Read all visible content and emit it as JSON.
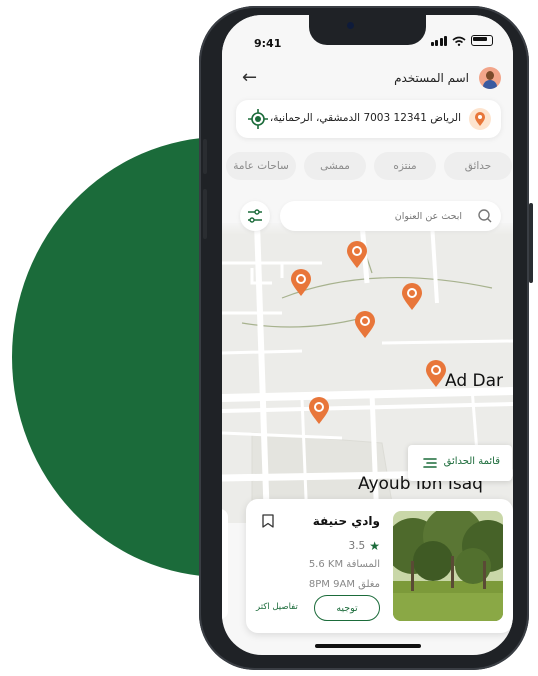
{
  "status_bar": {
    "time": "9:41"
  },
  "header": {
    "user_name": "اسم المستخدم"
  },
  "address": {
    "text": "الرياض 12341 7003 الدمشقي، الرحمانية،"
  },
  "categories": [
    {
      "label": "حدائق"
    },
    {
      "label": "منتزه"
    },
    {
      "label": "ممشى"
    },
    {
      "label": "ساحات عامة"
    }
  ],
  "search": {
    "placeholder": "ابحث عن العنوان"
  },
  "map": {
    "labels": {
      "street_1": "Ad Dar",
      "street_2": "Ayoub Ibn Isaq"
    },
    "park_list_button": "قائمة الحدائق",
    "pin_color": "#e8763a"
  },
  "park_card": {
    "name": "وادي حنيفة",
    "rating": "3.5",
    "distance_label": "المسافة",
    "distance_value": "5.6 KM",
    "hours_label": "مغلق",
    "open_time": "9AM",
    "close_time": "8PM",
    "direct_button": "توجيه",
    "more_link": "تفاصيل اكثر"
  },
  "colors": {
    "accent": "#1b6b3a",
    "pin": "#e8763a",
    "background_circle": "#1b6b3a"
  }
}
